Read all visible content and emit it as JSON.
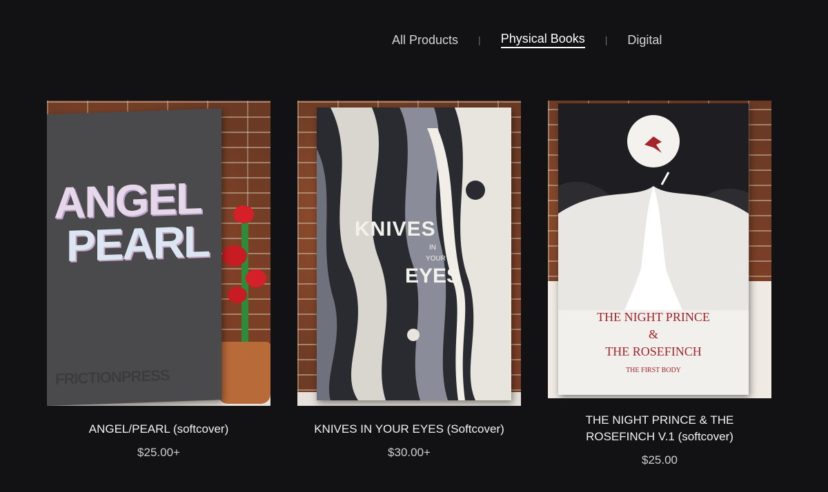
{
  "nav": {
    "items": [
      {
        "label": "All Products"
      },
      {
        "label": "Physical Books"
      },
      {
        "label": "Digital"
      }
    ],
    "separator": "|",
    "active": "Physical Books"
  },
  "products": [
    {
      "title": "ANGEL/PEARL (softcover)",
      "price": "$25.00+",
      "cover_text": {
        "line1": "ANGEL",
        "line2": "PEARL",
        "publisher": "FRICTIONPRESS"
      }
    },
    {
      "title": "KNIVES IN YOUR EYES (Softcover)",
      "price": "$30.00+",
      "cover_text": {
        "line1": "KNIVES",
        "line2": "IN",
        "line3": "YOUR",
        "line4": "EYES"
      }
    },
    {
      "title_line1": "THE NIGHT PRINCE & THE",
      "title_line2": "ROSEFINCH V.1 (softcover)",
      "price": "$25.00",
      "cover_text": {
        "line1": "THE NIGHT PRINCE",
        "line2": "&",
        "line3": "THE ROSEFINCH",
        "subtitle": "THE FIRST BODY"
      }
    }
  ],
  "colors": {
    "background": "#121113",
    "accent_red": "#a3242b"
  }
}
